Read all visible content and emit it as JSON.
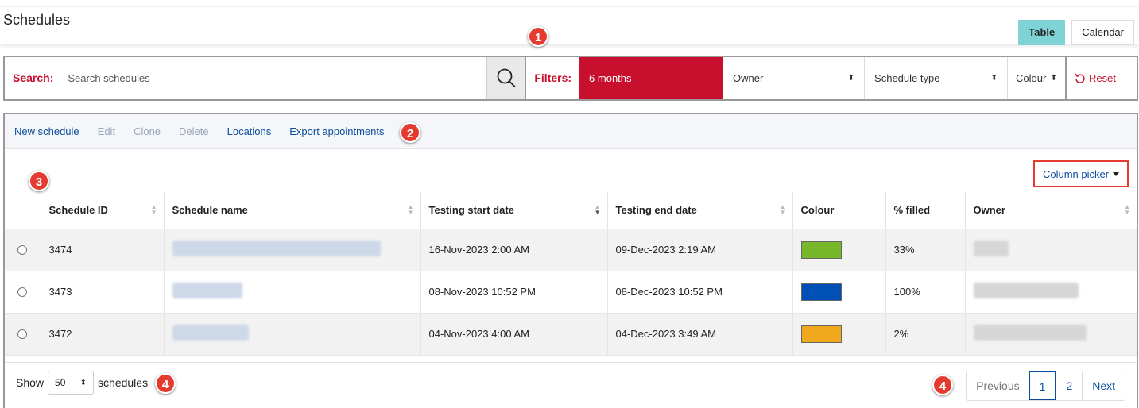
{
  "header": {
    "title": "Schedules",
    "tabs": [
      {
        "label": "Table",
        "active": true
      },
      {
        "label": "Calendar",
        "active": false
      }
    ]
  },
  "search": {
    "label": "Search:",
    "placeholder": "Search schedules",
    "icon": "search-icon"
  },
  "filters": {
    "label": "Filters:",
    "period": "6 months",
    "owner": "Owner",
    "schedule_type": "Schedule type",
    "colour": "Colour",
    "reset": "Reset"
  },
  "toolbar": {
    "actions": [
      {
        "label": "New schedule",
        "enabled": true
      },
      {
        "label": "Edit",
        "enabled": false
      },
      {
        "label": "Clone",
        "enabled": false
      },
      {
        "label": "Delete",
        "enabled": false
      },
      {
        "label": "Locations",
        "enabled": true
      },
      {
        "label": "Export appointments",
        "enabled": true
      }
    ],
    "column_picker": "Column picker"
  },
  "table": {
    "columns": [
      "Schedule ID",
      "Schedule name",
      "Testing start date",
      "Testing end date",
      "Colour",
      "% filled",
      "Owner"
    ],
    "rows": [
      {
        "id": "3474",
        "start": "16-Nov-2023 2:00 AM",
        "end": "09-Dec-2023 2:19 AM",
        "colour": "#76b82a",
        "filled": "33%"
      },
      {
        "id": "3473",
        "start": "08-Nov-2023 10:52 PM",
        "end": "08-Dec-2023 10:52 PM",
        "colour": "#0050b5",
        "filled": "100%"
      },
      {
        "id": "3472",
        "start": "04-Nov-2023 4:00 AM",
        "end": "04-Dec-2023 3:49 AM",
        "colour": "#f0a81c",
        "filled": "2%"
      }
    ]
  },
  "footer": {
    "show_label": "Show",
    "page_size": "50",
    "suffix": "schedules",
    "pagination": {
      "previous": "Previous",
      "pages": [
        "1",
        "2"
      ],
      "current": "1",
      "next": "Next"
    }
  },
  "callouts": [
    "1",
    "2",
    "3",
    "4",
    "4"
  ],
  "colors": {
    "accent_red": "#c8102e",
    "link_blue": "#0b4e9c",
    "tab_active": "#7fd3d6",
    "callout": "#e53a2f"
  }
}
